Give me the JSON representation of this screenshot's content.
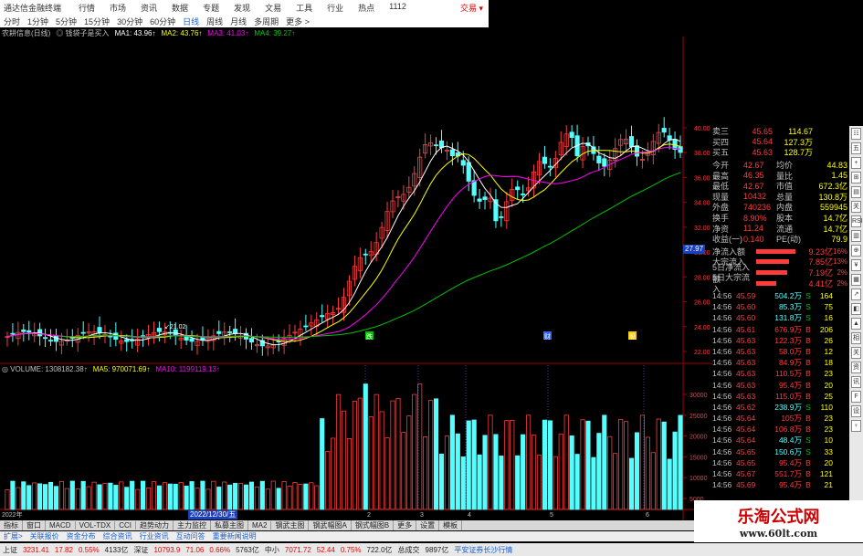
{
  "titlebar": {
    "app": "通达信金融终端",
    "menus": [
      "行情",
      "市场",
      "资讯",
      "数据",
      "专题",
      "发现",
      "文易",
      "工具",
      "行业",
      "热点",
      "1112"
    ],
    "trade": "交易 ▾"
  },
  "periods": [
    "分时",
    "1分钟",
    "5分钟",
    "15分钟",
    "30分钟",
    "60分钟",
    "日线",
    "周线",
    "月线",
    "多周期",
    "更多 >"
  ],
  "active_period": "日线",
  "ma_line": {
    "label": "农耕信息(日线)",
    "signal": "◎ 钱袋子是买入",
    "ma1": "MA1: 43.96↑",
    "ma2": "MA2: 43.76↑",
    "ma3": "MA3: 41.03↑",
    "ma4": "MA4: 39.27↑"
  },
  "volume_line": {
    "label": "◎ VOLUME: 1308182.38↑",
    "ma5": "MA5: 970071.69↑",
    "ma10": "MA10: 1199119.13↑"
  },
  "colors": {
    "up": "#ff3b3b",
    "down": "#54ffff",
    "ma1": "#ffffff",
    "ma2": "#ffff00",
    "ma3": "#ff00ff",
    "ma4": "#00c000",
    "bg": "#000000"
  },
  "price_axis": [
    "40.00",
    "38.00",
    "36.00",
    "34.00",
    "32.00",
    "30.00",
    "28.00",
    "26.00",
    "24.00",
    "22.00"
  ],
  "vol_axis": [
    "30000",
    "25000",
    "20000",
    "15000",
    "10000",
    "5000"
  ],
  "last_price_tag": "27.97",
  "annotations": {
    "low_tag": "↙21.02",
    "date_tag": "2022/12/30/五",
    "year_label": "2022年",
    "month_marks": [
      "2",
      "3",
      "4",
      "5",
      "6"
    ],
    "event_marks": [
      "跌",
      "财",
      "股"
    ]
  },
  "quotes": [
    {
      "k": "卖三",
      "p": "45.65",
      "s": "114.67"
    },
    {
      "k": "买四",
      "p": "45.64",
      "s": "127.3万"
    },
    {
      "k": "买五",
      "p": "45.63",
      "s": "128.7万"
    }
  ],
  "stats": [
    {
      "l1": "今开",
      "v1": "42.67",
      "l2": "均价",
      "v2": "44.83"
    },
    {
      "l1": "最高",
      "v1": "46.35",
      "l2": "量比",
      "v2": "1.45"
    },
    {
      "l1": "最低",
      "v1": "42.67",
      "l2": "市值",
      "v2": "672.3亿"
    },
    {
      "l1": "现量",
      "v1": "10432",
      "l2": "总量",
      "v2": "130.8万"
    },
    {
      "l1": "外盘",
      "v1": "740236",
      "l2": "内盘",
      "v2": "559945"
    },
    {
      "l1": "换手",
      "v1": "8.90%",
      "l2": "股本",
      "v2": "14.7亿"
    },
    {
      "l1": "净资",
      "v1": "11.24",
      "l2": "流通",
      "v2": "14.7亿"
    },
    {
      "l1": "收益(一)",
      "v1": "0.140",
      "l2": "PE(动)",
      "v2": "79.9"
    }
  ],
  "flows": [
    {
      "label": "净流入额",
      "fill": 0.9,
      "val": "9.23亿",
      "pct": "16%"
    },
    {
      "label": "大宗流入",
      "fill": 0.75,
      "val": "7.85亿",
      "pct": "13%"
    },
    {
      "label": "5日净流入额",
      "fill": 0.7,
      "val": "7.19亿",
      "pct": "2%"
    },
    {
      "label": "5日大宗流入",
      "fill": 0.45,
      "val": "4.41亿",
      "pct": "2%"
    }
  ],
  "ticks": [
    {
      "t": "14:56",
      "p": "45.59",
      "v": "504.2万",
      "s": "S",
      "n": "164"
    },
    {
      "t": "14:56",
      "p": "45.60",
      "v": "85.3万",
      "s": "S",
      "n": "75"
    },
    {
      "t": "14:56",
      "p": "45.60",
      "v": "131.8万",
      "s": "S",
      "n": "16"
    },
    {
      "t": "14:56",
      "p": "45.61",
      "v": "676.9万",
      "s": "B",
      "n": "206"
    },
    {
      "t": "14:56",
      "p": "45.63",
      "v": "122.3万",
      "s": "B",
      "n": "26"
    },
    {
      "t": "14:56",
      "p": "45.63",
      "v": "58.0万",
      "s": "B",
      "n": "12"
    },
    {
      "t": "14:56",
      "p": "45.63",
      "v": "84.9万",
      "s": "B",
      "n": "18"
    },
    {
      "t": "14:56",
      "p": "45.63",
      "v": "110.5万",
      "s": "B",
      "n": "23"
    },
    {
      "t": "14:56",
      "p": "45.63",
      "v": "95.4万",
      "s": "B",
      "n": "20"
    },
    {
      "t": "14:56",
      "p": "45.63",
      "v": "115.0万",
      "s": "B",
      "n": "25"
    },
    {
      "t": "14:56",
      "p": "45.62",
      "v": "238.9万",
      "s": "S",
      "n": "110"
    },
    {
      "t": "14:56",
      "p": "45.64",
      "v": "105万",
      "s": "B",
      "n": "23"
    },
    {
      "t": "14:56",
      "p": "45.64",
      "v": "106.8万",
      "s": "B",
      "n": "23"
    },
    {
      "t": "14:56",
      "p": "45.64",
      "v": "48.4万",
      "s": "S",
      "n": "10"
    },
    {
      "t": "14:56",
      "p": "45.65",
      "v": "150.6万",
      "s": "S",
      "n": "33"
    },
    {
      "t": "14:56",
      "p": "45.65",
      "v": "95.4万",
      "s": "B",
      "n": "20"
    },
    {
      "t": "14:56",
      "p": "45.67",
      "v": "551.7万",
      "s": "B",
      "n": "121"
    },
    {
      "t": "14:56",
      "p": "45.69",
      "v": "95.4万",
      "s": "B",
      "n": "21"
    }
  ],
  "sidebar_icons": [
    "☷",
    "五",
    "+",
    "⊞",
    "▤",
    "关",
    "RSI",
    "▥",
    "⊕",
    "¥",
    "▦",
    "↗",
    "◧",
    "▲",
    "相",
    "关",
    "资",
    "讯",
    "F",
    "设",
    "♀"
  ],
  "tabs": [
    "指标",
    "窗口",
    "MACD",
    "VOL-TDX",
    "CCI",
    "趋势动力",
    "主力监控",
    "私募主图",
    "MA2",
    "钢武主图",
    "钢武幅图A",
    "钢式幅图B",
    "更多",
    "设置",
    "模板"
  ],
  "subtabs": [
    "扩展>",
    "关联报价",
    "资金分布",
    "综合资讯",
    "行业资讯",
    "互动问答",
    "重要新闻说明"
  ],
  "status": [
    {
      "text": "上证",
      "cls": ""
    },
    {
      "text": "3231.41",
      "cls": "red"
    },
    {
      "text": "17.82",
      "cls": "red"
    },
    {
      "text": "0.55%",
      "cls": "red"
    },
    {
      "text": "4133亿",
      "cls": ""
    },
    {
      "text": "深证",
      "cls": ""
    },
    {
      "text": "10793.9",
      "cls": "red"
    },
    {
      "text": "71.06",
      "cls": "red"
    },
    {
      "text": "0.66%",
      "cls": "red"
    },
    {
      "text": "5763亿",
      "cls": ""
    },
    {
      "text": "中小",
      "cls": ""
    },
    {
      "text": "7071.72",
      "cls": "red"
    },
    {
      "text": "52.44",
      "cls": "red"
    },
    {
      "text": "0.75%",
      "cls": "red"
    },
    {
      "text": "722.0亿",
      "cls": ""
    },
    {
      "text": "总成交",
      "cls": ""
    },
    {
      "text": "9897亿",
      "cls": ""
    },
    {
      "text": "平安证券长沙行情",
      "cls": "blue"
    }
  ],
  "watermark": {
    "big": "乐淘公式网",
    "small": "www.60lt.com"
  },
  "chart_data": {
    "type": "candlestick",
    "series": [
      {
        "name": "MA1",
        "values": []
      },
      {
        "name": "MA2",
        "values": []
      },
      {
        "name": "MA3",
        "values": []
      },
      {
        "name": "MA4",
        "values": []
      }
    ],
    "ylim": [
      21,
      41
    ]
  }
}
